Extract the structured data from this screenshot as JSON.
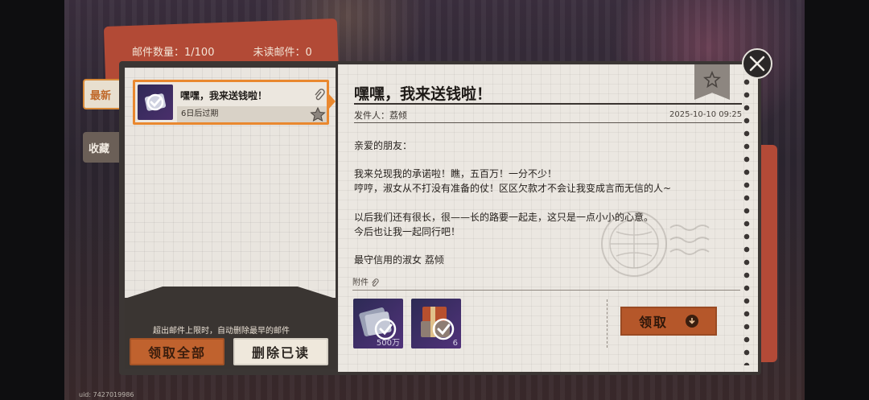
{
  "header": {
    "mail_count": "邮件数量：1/100",
    "unread_count": "未读邮件：0"
  },
  "tabs": {
    "latest": "最新",
    "favorites": "收藏"
  },
  "mail_list": [
    {
      "title": "嘿嘿，我来送钱啦！",
      "expiry": "6日后过期"
    }
  ],
  "footer": {
    "notice": "超出邮件上限时，自动删除最早的邮件",
    "claim_all": "领取全部",
    "delete_read": "删除已读"
  },
  "letter": {
    "title": "嘿嘿，我来送钱啦！",
    "sender": "发件人：荔倾",
    "date": "2025-10-10 09:25",
    "body": [
      "亲爱的朋友：",
      "我来兑现我的承诺啦！瞧，五百万！一分不少！",
      "哼哼，淑女从不打没有准备的仗！区区欠款才不会让我变成言而无信的人~",
      "以后我们还有很长，很——长的路要一起走，这只是一点小小的心意。",
      "今后也让我一起同行吧！",
      "最守信用的淑女 荔倾"
    ],
    "attachment_label": "附件",
    "attachments": [
      {
        "count": "500万",
        "icon": "coin-stack-icon"
      },
      {
        "count": "6",
        "icon": "gift-crate-icon"
      }
    ],
    "claim_button": "领取"
  },
  "uid": "uid: 7427019986",
  "colors": {
    "accent_orange": "#e9882f",
    "button_brown": "#b5572a",
    "paper": "#ebe7e1"
  }
}
